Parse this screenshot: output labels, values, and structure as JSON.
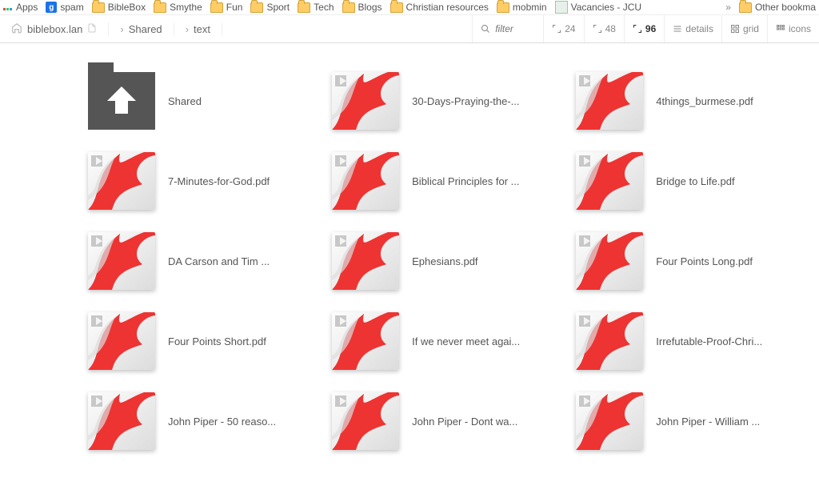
{
  "bookmarks": {
    "apps": "Apps",
    "items": [
      "spam",
      "BibleBox",
      "Smythe",
      "Fun",
      "Sport",
      "Tech",
      "Blogs",
      "Christian resources",
      "mobmin",
      "Vacancies - JCU"
    ],
    "overflow": "»",
    "other": "Other bookma"
  },
  "breadcrumb": [
    "biblebox.lan",
    "Shared",
    "text"
  ],
  "toolbar": {
    "filter_placeholder": "filter",
    "zoom": [
      "24",
      "48",
      "96"
    ],
    "views": [
      "details",
      "grid",
      "icons"
    ]
  },
  "files": [
    {
      "type": "folder-up",
      "name": "Shared"
    },
    {
      "type": "pdf",
      "name": "30-Days-Praying-the-..."
    },
    {
      "type": "pdf",
      "name": "4things_burmese.pdf"
    },
    {
      "type": "pdf",
      "name": "7-Minutes-for-God.pdf"
    },
    {
      "type": "pdf",
      "name": "Biblical Principles for ..."
    },
    {
      "type": "pdf",
      "name": "Bridge to Life.pdf"
    },
    {
      "type": "pdf",
      "name": "DA Carson and Tim ..."
    },
    {
      "type": "pdf",
      "name": "Ephesians.pdf"
    },
    {
      "type": "pdf",
      "name": "Four Points Long.pdf"
    },
    {
      "type": "pdf",
      "name": "Four Points Short.pdf"
    },
    {
      "type": "pdf",
      "name": "If we never meet agai..."
    },
    {
      "type": "pdf",
      "name": "Irrefutable-Proof-Chri..."
    },
    {
      "type": "pdf",
      "name": "John Piper - 50 reaso..."
    },
    {
      "type": "pdf",
      "name": "John Piper - Dont wa..."
    },
    {
      "type": "pdf",
      "name": "John Piper - William ..."
    }
  ]
}
